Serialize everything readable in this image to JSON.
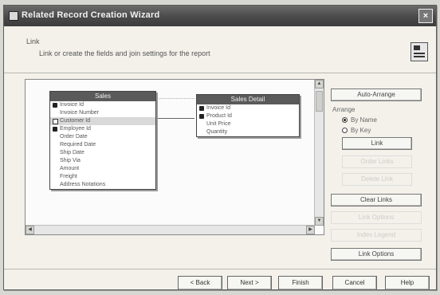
{
  "window": {
    "title": "Related Record Creation Wizard",
    "close_glyph": "×"
  },
  "header": {
    "label": "Link",
    "description": "Link or create the fields and join settings for the report"
  },
  "tables": [
    {
      "title": "Sales",
      "fields": [
        {
          "name": "Invoice Id",
          "marker": "key"
        },
        {
          "name": "Invoice Number",
          "marker": "none"
        },
        {
          "name": "Customer Id",
          "marker": "chk",
          "selected": true
        },
        {
          "name": "Employee Id",
          "marker": "key"
        },
        {
          "name": "Order Date",
          "marker": "none"
        },
        {
          "name": "Required Date",
          "marker": "none"
        },
        {
          "name": "Ship Date",
          "marker": "none"
        },
        {
          "name": "Ship Via",
          "marker": "none"
        },
        {
          "name": "Amount",
          "marker": "none"
        },
        {
          "name": "Freight",
          "marker": "none"
        },
        {
          "name": "Address Notations",
          "marker": "none"
        }
      ]
    },
    {
      "title": "Sales Detail",
      "fields": [
        {
          "name": "Invoice Id",
          "marker": "key"
        },
        {
          "name": "Product Id",
          "marker": "key"
        },
        {
          "name": "Unit Price",
          "marker": "none"
        },
        {
          "name": "Quantity",
          "marker": "none"
        }
      ]
    }
  ],
  "side_panel": {
    "auto_arrange": "Auto-Arrange",
    "arrange_label": "Arrange",
    "by_name": "By Name",
    "by_key": "By Key",
    "link": "Link",
    "order_links": "Order Links",
    "clear_links": "Clear Links",
    "delete_link": "Delete Link",
    "link_options": "Link Options",
    "index_legend": "Index Legend"
  },
  "footer": {
    "back": "< Back",
    "next": "Next >",
    "finish": "Finish",
    "cancel": "Cancel",
    "help": "Help"
  },
  "colors": {
    "titlebar": "#4a4a4a",
    "window_bg": "#f3f1ea",
    "table_header": "#5a5a5a"
  }
}
